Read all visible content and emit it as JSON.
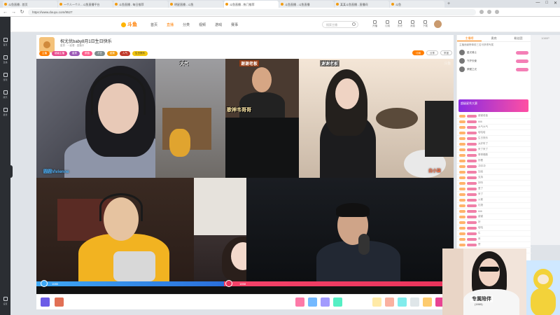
{
  "browser": {
    "tabs": [
      {
        "label": "斗鱼直播 - 首页"
      },
      {
        "label": "一个人一个人 - 斗鱼直播平台"
      },
      {
        "label": "斗鱼直播 - 每日推荐"
      },
      {
        "label": "明星直播 - 斗鱼"
      },
      {
        "label": "斗鱼直播 - 热门推荐"
      },
      {
        "label": "斗鱼直播 - 斗鱼直播"
      },
      {
        "label": "某某斗鱼直播 - 直播间"
      },
      {
        "label": "斗鱼"
      }
    ],
    "url": "https://www.douyu.com/9527",
    "new_tab": "+",
    "window_controls": {
      "minimize": "—",
      "maximize": "□",
      "close": "✕"
    },
    "back": "←",
    "forward": "→",
    "reload": "↻"
  },
  "leftbar": {
    "items": [
      {
        "label": "首页"
      },
      {
        "label": "直播"
      },
      {
        "label": "游戏"
      },
      {
        "label": "娱乐"
      },
      {
        "label": "星秀"
      },
      {
        "label": "设置"
      }
    ]
  },
  "header": {
    "logo": "斗鱼",
    "nav": [
      {
        "label": "首页"
      },
      {
        "label": "直播"
      },
      {
        "label": "分类"
      },
      {
        "label": "视频"
      },
      {
        "label": "游戏"
      },
      {
        "label": "赛事"
      }
    ],
    "search_placeholder": "搜索主播",
    "icons": [
      {
        "label": "开播"
      },
      {
        "label": "订阅"
      },
      {
        "label": "历史"
      },
      {
        "label": "消息"
      },
      {
        "label": "下载"
      },
      {
        "label": "创作"
      }
    ]
  },
  "room": {
    "title": "祝尤优baby8月1日生日快乐",
    "meta": "星秀 · 一起看 · 直播中",
    "badges": [
      {
        "label": "主播",
        "color": "#ff7e00"
      },
      {
        "label": "超级主播",
        "color": "#e84a8c"
      },
      {
        "label": "星秀",
        "color": "#9b59b6"
      },
      {
        "label": "颜值",
        "color": "#ff5b8a"
      },
      {
        "label": "才艺",
        "color": "#7f8c8d"
      },
      {
        "label": "甜美",
        "color": "#f39c12"
      },
      {
        "label": "人气",
        "color": "#c0392b"
      },
      {
        "label": "生日快乐",
        "color": "#f1c40f"
      }
    ],
    "actions": [
      {
        "label": "订阅",
        "kind": "sub"
      },
      {
        "label": "分享"
      },
      {
        "label": "举报"
      }
    ]
  },
  "video": {
    "watermark": "斗鱼",
    "banners": [
      {
        "text": "谢谢老板"
      },
      {
        "text": "歌神韦哥哥"
      },
      {
        "text": "谢谢老板"
      },
      {
        "text": "大气"
      },
      {
        "text": "观战"
      }
    ],
    "nametags": [
      {
        "text": "圆圆Vivienne"
      },
      {
        "text": "白小柒"
      }
    ],
    "pk": {
      "left": "1085",
      "right": "1858"
    }
  },
  "chat": {
    "tabs": [
      {
        "label": "主播榜"
      },
      {
        "label": "贵宾"
      },
      {
        "label": "粉丝团"
      }
    ],
    "rank_note": "主播贡献榜单前三名可获得专属",
    "ranks": [
      {
        "name": "星光骑士"
      },
      {
        "name": "守护天使"
      },
      {
        "name": "荣耀之光"
      }
    ],
    "promo": "超级星秀大赛",
    "lines": [
      {
        "text": "谢谢老板"
      },
      {
        "text": "666"
      },
      {
        "text": "大气大气"
      },
      {
        "text": "哈哈哈"
      },
      {
        "text": "生日快乐"
      },
      {
        "text": "太好听了"
      },
      {
        "text": "来了来了"
      },
      {
        "text": "哥哥唱歌"
      },
      {
        "text": "好看"
      },
      {
        "text": "冲冲冲"
      },
      {
        "text": "加油"
      },
      {
        "text": "支持"
      },
      {
        "text": "好听"
      },
      {
        "text": "爱了"
      },
      {
        "text": "来了"
      },
      {
        "text": "火箭"
      },
      {
        "text": "礼物"
      },
      {
        "text": "666"
      },
      {
        "text": "谢谢"
      },
      {
        "text": "好"
      },
      {
        "text": "哈哈"
      },
      {
        "text": "牛"
      },
      {
        "text": "来"
      },
      {
        "text": "赞"
      },
      {
        "text": "强"
      }
    ]
  },
  "rightedge": {
    "label": "1080P"
  },
  "webcam": {
    "label": "专属陪伴",
    "sub": "(1865)"
  }
}
